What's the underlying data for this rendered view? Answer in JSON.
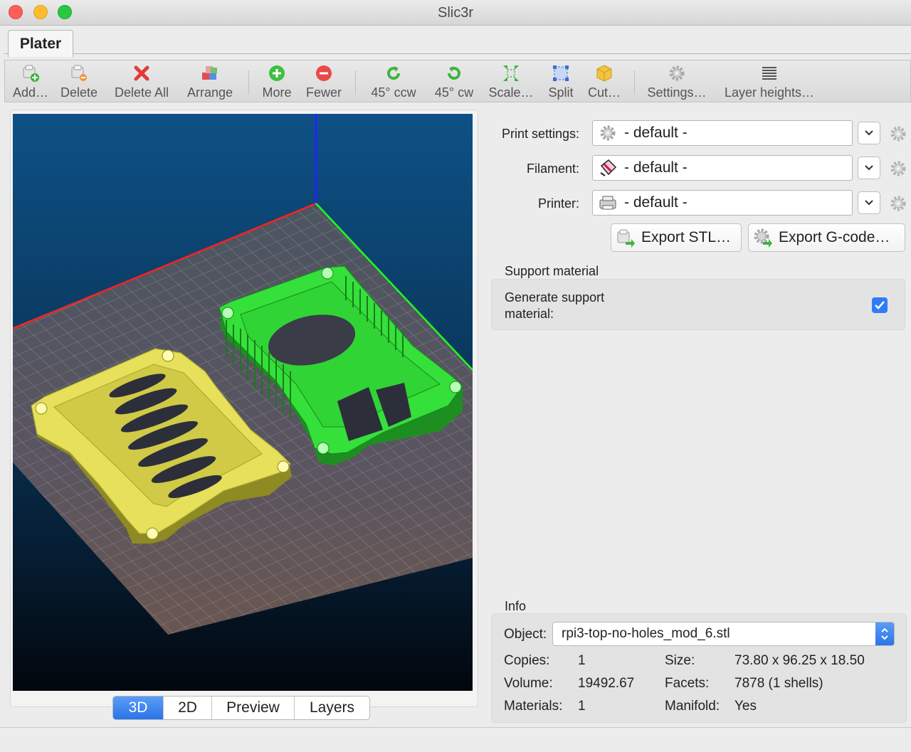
{
  "window": {
    "title": "Slic3r"
  },
  "tabs": [
    {
      "label": "Plater"
    }
  ],
  "toolbar": {
    "items": [
      {
        "label": "Add…",
        "icon": "add-object-icon"
      },
      {
        "label": "Delete",
        "icon": "delete-object-icon"
      },
      {
        "label": "Delete All",
        "icon": "delete-all-icon"
      },
      {
        "label": "Arrange",
        "icon": "arrange-icon"
      },
      {
        "label": "More",
        "icon": "plus-circle-icon"
      },
      {
        "label": "Fewer",
        "icon": "minus-circle-icon"
      },
      {
        "label": "45° ccw",
        "icon": "rotate-ccw-icon"
      },
      {
        "label": "45° cw",
        "icon": "rotate-cw-icon"
      },
      {
        "label": "Scale…",
        "icon": "scale-icon"
      },
      {
        "label": "Split",
        "icon": "split-icon"
      },
      {
        "label": "Cut…",
        "icon": "cut-icon"
      },
      {
        "label": "Settings…",
        "icon": "gear-icon"
      },
      {
        "label": "Layer heights…",
        "icon": "layers-icon"
      }
    ]
  },
  "view_tabs": [
    {
      "label": "3D",
      "active": true
    },
    {
      "label": "2D",
      "active": false
    },
    {
      "label": "Preview",
      "active": false
    },
    {
      "label": "Layers",
      "active": false
    }
  ],
  "presets": {
    "print": {
      "label": "Print settings:",
      "value": "- default -",
      "icon": "gear-icon"
    },
    "filament": {
      "label": "Filament:",
      "value": "- default -",
      "icon": "filament-spool-icon"
    },
    "printer": {
      "label": "Printer:",
      "value": "- default -",
      "icon": "printer-icon"
    }
  },
  "export": {
    "stl_label": "Export STL…",
    "gcode_label": "Export G-code…"
  },
  "support": {
    "title": "Support material",
    "generate_label_line1": "Generate support",
    "generate_label_line2": "material:",
    "checked": true
  },
  "info": {
    "title": "Info",
    "object_label": "Object:",
    "object_value": "rpi3-top-no-holes_mod_6.stl",
    "copies_label": "Copies:",
    "copies_value": "1",
    "volume_label": "Volume:",
    "volume_value": "19492.67",
    "materials_label": "Materials:",
    "materials_value": "1",
    "size_label": "Size:",
    "size_value": "73.80 x 96.25 x 18.50",
    "facets_label": "Facets:",
    "facets_value": "7878 (1 shells)",
    "manifold_label": "Manifold:",
    "manifold_value": "Yes"
  },
  "colors": {
    "accent": "#2f7cf6",
    "object_yellow": "#e6e05a",
    "object_green": "#35e03a",
    "axis_x": "#ff2020",
    "axis_y": "#20ff20",
    "axis_z": "#2020ff"
  }
}
